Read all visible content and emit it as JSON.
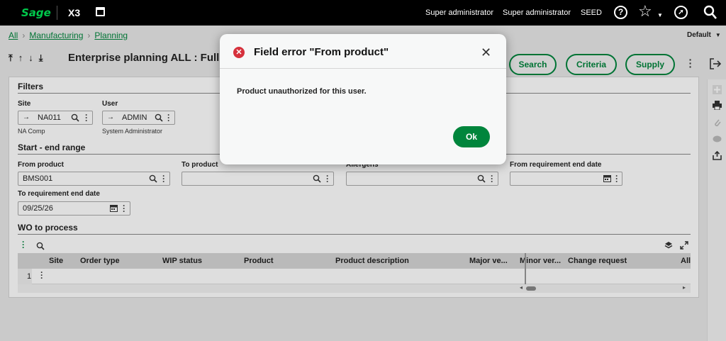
{
  "topbar": {
    "logo": "Sage",
    "product": "X3",
    "user1": "Super administrator",
    "user2": "Super administrator",
    "folder": "SEED"
  },
  "breadcrumb": {
    "items": [
      "All",
      "Manufacturing",
      "Planning"
    ]
  },
  "layout_selector": "Default",
  "page": {
    "title": "Enterprise planning ALL : Full enterprise planning",
    "buttons": {
      "search": "Search",
      "criteria": "Criteria",
      "supply": "Supply"
    }
  },
  "filters": {
    "heading": "Filters",
    "site": {
      "label": "Site",
      "value": "NA011",
      "sub": "NA Comp"
    },
    "user": {
      "label": "User",
      "value": "ADMIN",
      "sub": "System Administrator"
    }
  },
  "range": {
    "heading": "Start - end range",
    "from_product": {
      "label": "From product",
      "value": "BMS001"
    },
    "to_product": {
      "label": "To product",
      "value": ""
    },
    "allergens": {
      "label": "Allergens",
      "value": ""
    },
    "from_req_end": {
      "label": "From requirement end date",
      "value": ""
    },
    "to_req_end": {
      "label": "To requirement end date",
      "value": "09/25/26"
    }
  },
  "wo": {
    "heading": "WO to process",
    "columns": [
      "Site",
      "Order type",
      "WIP status",
      "Product",
      "Product description",
      "Major ve...",
      "Minor ver...",
      "Change request",
      "All"
    ],
    "rows": [
      {
        "num": "1"
      }
    ]
  },
  "dialog": {
    "title": "Field error \"From product\"",
    "message": "Product unauthorized for this user.",
    "ok": "Ok"
  },
  "colors": {
    "accent": "#00853c",
    "error": "#d6313c"
  }
}
